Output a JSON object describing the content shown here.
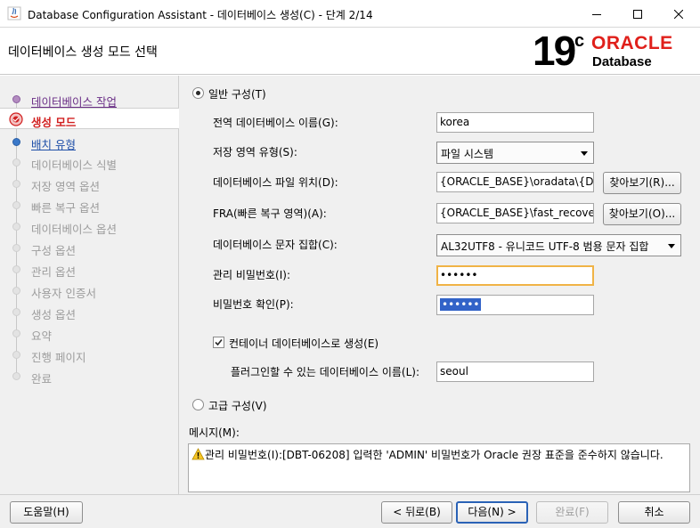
{
  "window": {
    "title": "Database Configuration Assistant - 데이터베이스 생성(C) - 단계 2/14",
    "controls": [
      "minimize",
      "maximize",
      "close"
    ]
  },
  "header": {
    "title": "데이터베이스 생성 모드 선택",
    "logo_version": "19",
    "logo_superscript": "c",
    "logo_brand": "ORACLE",
    "logo_product": "Database",
    "brand_color": "#e0201b"
  },
  "nav": {
    "items": [
      {
        "label": "데이터베이스 작업",
        "state": "done"
      },
      {
        "label": "생성 모드",
        "state": "current"
      },
      {
        "label": "배치 유형",
        "state": "link"
      },
      {
        "label": "데이터베이스 식별",
        "state": "disabled"
      },
      {
        "label": "저장 영역 옵션",
        "state": "disabled"
      },
      {
        "label": "빠른 복구 옵션",
        "state": "disabled"
      },
      {
        "label": "데이터베이스 옵션",
        "state": "disabled"
      },
      {
        "label": "구성 옵션",
        "state": "disabled"
      },
      {
        "label": "관리 옵션",
        "state": "disabled"
      },
      {
        "label": "사용자 인증서",
        "state": "disabled"
      },
      {
        "label": "생성 옵션",
        "state": "disabled"
      },
      {
        "label": "요약",
        "state": "disabled"
      },
      {
        "label": "진행 페이지",
        "state": "disabled"
      },
      {
        "label": "완료",
        "state": "disabled"
      }
    ]
  },
  "form": {
    "typical_label": "일반 구성(T)",
    "typical_selected": true,
    "global_db_name_label": "전역 데이터베이스 이름(G):",
    "global_db_name_value": "korea",
    "storage_type_label": "저장 영역 유형(S):",
    "storage_type_value": "파일 시스템",
    "db_file_location_label": "데이터베이스 파일 위치(D):",
    "db_file_location_value": "{ORACLE_BASE}\\oradata\\{DB_",
    "browse_r_label": "찾아보기(R)...",
    "fra_label": "FRA(빠른 복구 영역)(A):",
    "fra_value": "{ORACLE_BASE}\\fast_recovery_",
    "browse_o_label": "찾아보기(O)...",
    "charset_label": "데이터베이스 문자 집합(C):",
    "charset_value": "AL32UTF8 - 유니코드 UTF-8 범용 문자 집합",
    "admin_pw_label": "관리 비밀번호(I):",
    "admin_pw_value": "••••••",
    "confirm_pw_label": "비밀번호 확인(P):",
    "confirm_pw_value": "••••••",
    "container_label": "컨테이너 데이터베이스로 생성(E)",
    "container_checked": true,
    "pdb_name_label": "플러그인할 수 있는 데이터베이스 이름(L):",
    "pdb_name_value": "seoul",
    "advanced_label": "고급 구성(V)",
    "advanced_selected": false
  },
  "messages": {
    "label": "메시지(M):",
    "text": "관리 비밀번호(I):[DBT-06208] 입력한 'ADMIN' 비밀번호가 Oracle 권장 표준을 준수하지 않습니다."
  },
  "footer": {
    "help": "도움말(H)",
    "back": "< 뒤로(B)",
    "next": "다음(N) >",
    "finish": "완료(F)",
    "cancel": "취소"
  }
}
